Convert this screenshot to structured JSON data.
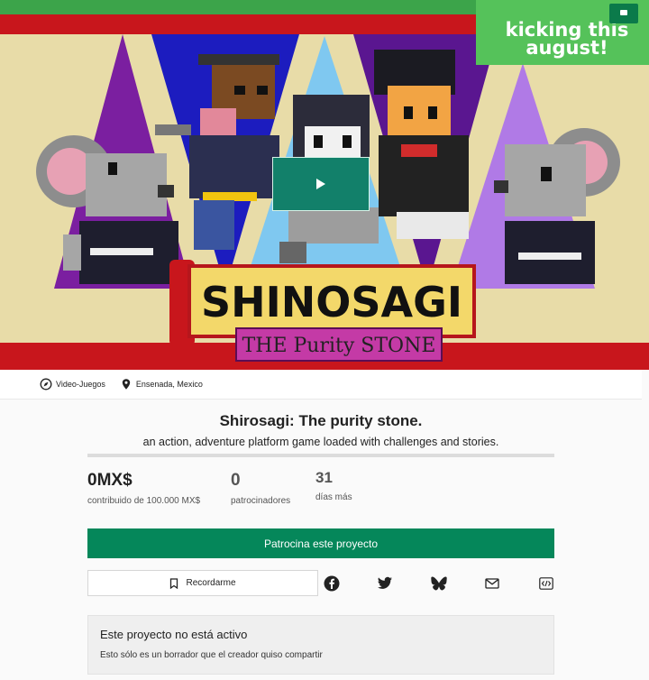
{
  "hero": {
    "banner_text": "kicking this august!",
    "logo_title": "SHINOSAGI",
    "logo_subtitle": "THE Purity STONE"
  },
  "meta": {
    "category": "Video-Juegos",
    "location": "Ensenada, Mexico"
  },
  "project": {
    "title": "Shirosagi: The purity stone.",
    "subtitle": "an action, adventure platform game loaded with challenges and stories."
  },
  "progress": {
    "funded_fraction": 0
  },
  "stats": {
    "pledged_value": "0MX$",
    "pledged_label": "contribuido de 100.000 MX$",
    "backers_value": "0",
    "backers_label": "patrocinadores",
    "days_value": "31",
    "days_label": "días más"
  },
  "actions": {
    "back_label": "Patrocina este proyecto",
    "remind_label": "Recordarme"
  },
  "share_icons": [
    "facebook-icon",
    "twitter-icon",
    "bluesky-icon",
    "email-icon",
    "embed-icon"
  ],
  "notice": {
    "heading": "Este proyecto no está activo",
    "body": "Esto sólo es un borrador que el creador quiso compartir"
  },
  "colors": {
    "accent_green": "#05875a",
    "banner_green": "#55c25a",
    "hero_red": "#c8161c",
    "hero_cream": "#e8dca8"
  }
}
